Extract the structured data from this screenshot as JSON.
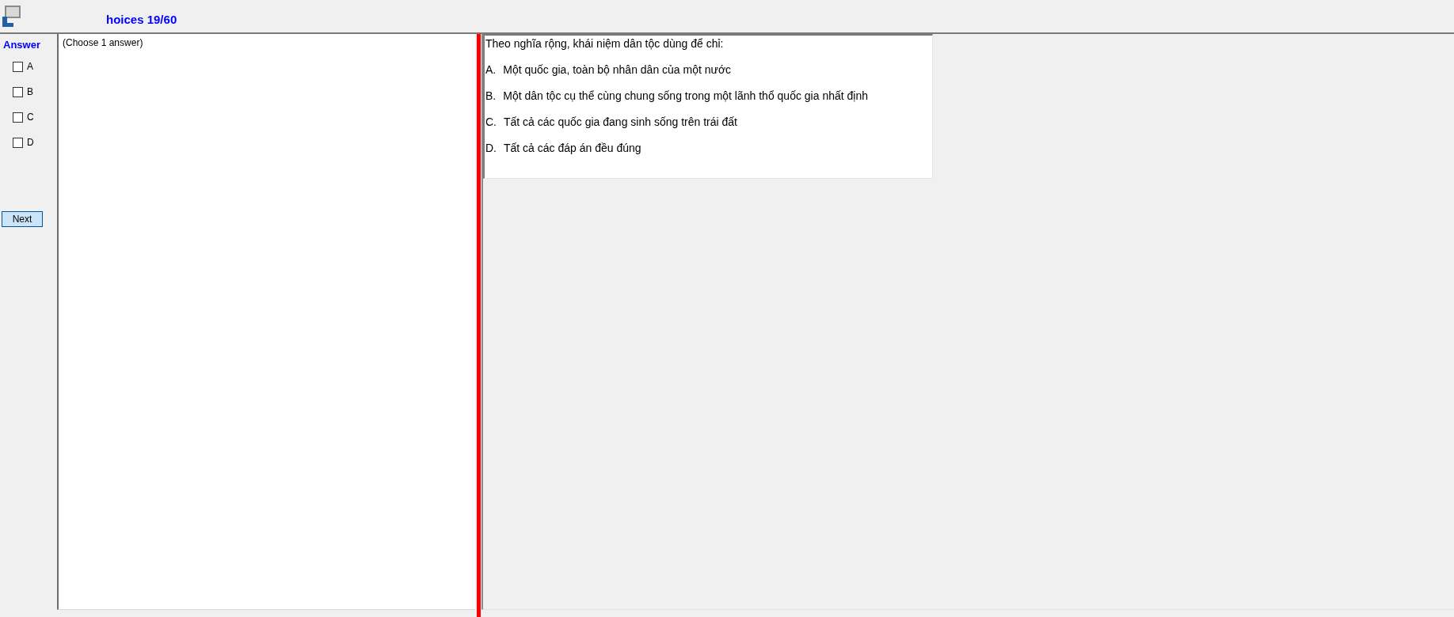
{
  "window": {
    "title": "hoices 19/60"
  },
  "answer_panel": {
    "heading": "Answer",
    "options": [
      {
        "label": "A",
        "checked": false
      },
      {
        "label": "B",
        "checked": false
      },
      {
        "label": "C",
        "checked": false
      },
      {
        "label": "D",
        "checked": false
      }
    ],
    "next_button": "Next"
  },
  "answer_area": {
    "instruction": "(Choose 1 answer)"
  },
  "question": {
    "text": "Theo nghĩa rộng, khái niệm dân tộc dùng để chỉ:",
    "choices": [
      {
        "letter": "A.",
        "text": "Một quốc gia, toàn bộ nhân dân của một nước"
      },
      {
        "letter": "B.",
        "text": "Một dân tộc cụ thể cùng chung sống trong một lãnh thổ quốc gia nhất định"
      },
      {
        "letter": "C.",
        "text": "Tất cả các quốc gia đang sinh sống trên trái đất"
      },
      {
        "letter": "D.",
        "text": "Tất cả các đáp án đều đúng"
      }
    ]
  }
}
